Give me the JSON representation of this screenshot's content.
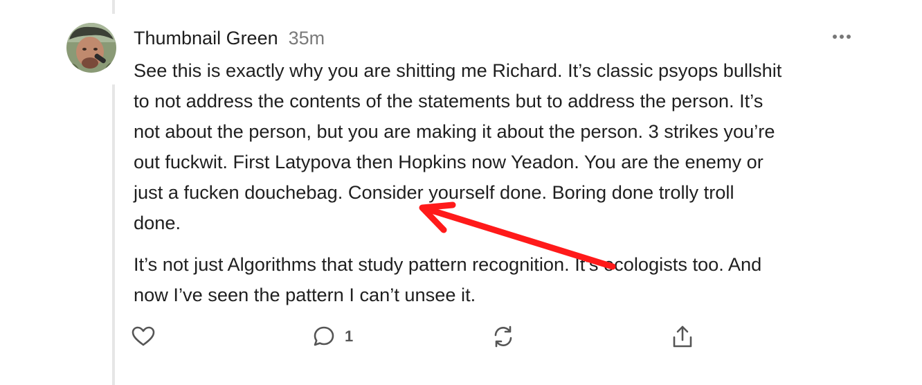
{
  "comment": {
    "author": "Thumbnail Green",
    "timestamp": "35m",
    "paragraphs": [
      [
        "See this is exactly why you are shitting me Richard. It’s classic psyops bullshit",
        "to not address the contents of the statements but to address the person. It’s",
        "not about the person, but you are making it about the person. 3 strikes you’re",
        "out fuckwit. First Latypova then Hopkins now Yeadon. You are the enemy or",
        "just a fucken douchebag. Consider yourself done. Boring done trolly troll",
        "done."
      ],
      [
        "It’s not just Algorithms that study pattern recognition. It’s ecologists too. And",
        "now I’ve seen the pattern I can’t unsee it."
      ]
    ],
    "actions": {
      "like_icon": "heart-icon",
      "comment_icon": "speech-bubble-icon",
      "comment_count": "1",
      "restack_icon": "restack-icon",
      "share_icon": "share-icon"
    },
    "more_icon": "more-horizontal-icon"
  },
  "annotation": {
    "type": "red-arrow",
    "color": "#ff1a1a"
  },
  "colors": {
    "thread_line": "#e6e6e6",
    "text": "#1f1f1f",
    "muted": "#7a7a7a",
    "icon": "#555555"
  }
}
